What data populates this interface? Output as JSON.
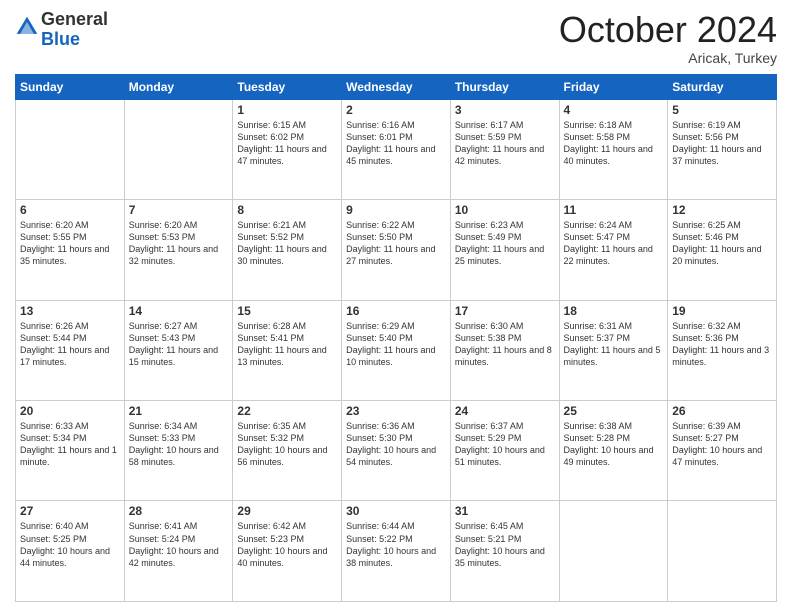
{
  "header": {
    "logo_line1": "General",
    "logo_line2": "Blue",
    "month": "October 2024",
    "location": "Aricak, Turkey"
  },
  "days_of_week": [
    "Sunday",
    "Monday",
    "Tuesday",
    "Wednesday",
    "Thursday",
    "Friday",
    "Saturday"
  ],
  "weeks": [
    [
      {
        "day": "",
        "info": ""
      },
      {
        "day": "",
        "info": ""
      },
      {
        "day": "1",
        "info": "Sunrise: 6:15 AM\nSunset: 6:02 PM\nDaylight: 11 hours and 47 minutes."
      },
      {
        "day": "2",
        "info": "Sunrise: 6:16 AM\nSunset: 6:01 PM\nDaylight: 11 hours and 45 minutes."
      },
      {
        "day": "3",
        "info": "Sunrise: 6:17 AM\nSunset: 5:59 PM\nDaylight: 11 hours and 42 minutes."
      },
      {
        "day": "4",
        "info": "Sunrise: 6:18 AM\nSunset: 5:58 PM\nDaylight: 11 hours and 40 minutes."
      },
      {
        "day": "5",
        "info": "Sunrise: 6:19 AM\nSunset: 5:56 PM\nDaylight: 11 hours and 37 minutes."
      }
    ],
    [
      {
        "day": "6",
        "info": "Sunrise: 6:20 AM\nSunset: 5:55 PM\nDaylight: 11 hours and 35 minutes."
      },
      {
        "day": "7",
        "info": "Sunrise: 6:20 AM\nSunset: 5:53 PM\nDaylight: 11 hours and 32 minutes."
      },
      {
        "day": "8",
        "info": "Sunrise: 6:21 AM\nSunset: 5:52 PM\nDaylight: 11 hours and 30 minutes."
      },
      {
        "day": "9",
        "info": "Sunrise: 6:22 AM\nSunset: 5:50 PM\nDaylight: 11 hours and 27 minutes."
      },
      {
        "day": "10",
        "info": "Sunrise: 6:23 AM\nSunset: 5:49 PM\nDaylight: 11 hours and 25 minutes."
      },
      {
        "day": "11",
        "info": "Sunrise: 6:24 AM\nSunset: 5:47 PM\nDaylight: 11 hours and 22 minutes."
      },
      {
        "day": "12",
        "info": "Sunrise: 6:25 AM\nSunset: 5:46 PM\nDaylight: 11 hours and 20 minutes."
      }
    ],
    [
      {
        "day": "13",
        "info": "Sunrise: 6:26 AM\nSunset: 5:44 PM\nDaylight: 11 hours and 17 minutes."
      },
      {
        "day": "14",
        "info": "Sunrise: 6:27 AM\nSunset: 5:43 PM\nDaylight: 11 hours and 15 minutes."
      },
      {
        "day": "15",
        "info": "Sunrise: 6:28 AM\nSunset: 5:41 PM\nDaylight: 11 hours and 13 minutes."
      },
      {
        "day": "16",
        "info": "Sunrise: 6:29 AM\nSunset: 5:40 PM\nDaylight: 11 hours and 10 minutes."
      },
      {
        "day": "17",
        "info": "Sunrise: 6:30 AM\nSunset: 5:38 PM\nDaylight: 11 hours and 8 minutes."
      },
      {
        "day": "18",
        "info": "Sunrise: 6:31 AM\nSunset: 5:37 PM\nDaylight: 11 hours and 5 minutes."
      },
      {
        "day": "19",
        "info": "Sunrise: 6:32 AM\nSunset: 5:36 PM\nDaylight: 11 hours and 3 minutes."
      }
    ],
    [
      {
        "day": "20",
        "info": "Sunrise: 6:33 AM\nSunset: 5:34 PM\nDaylight: 11 hours and 1 minute."
      },
      {
        "day": "21",
        "info": "Sunrise: 6:34 AM\nSunset: 5:33 PM\nDaylight: 10 hours and 58 minutes."
      },
      {
        "day": "22",
        "info": "Sunrise: 6:35 AM\nSunset: 5:32 PM\nDaylight: 10 hours and 56 minutes."
      },
      {
        "day": "23",
        "info": "Sunrise: 6:36 AM\nSunset: 5:30 PM\nDaylight: 10 hours and 54 minutes."
      },
      {
        "day": "24",
        "info": "Sunrise: 6:37 AM\nSunset: 5:29 PM\nDaylight: 10 hours and 51 minutes."
      },
      {
        "day": "25",
        "info": "Sunrise: 6:38 AM\nSunset: 5:28 PM\nDaylight: 10 hours and 49 minutes."
      },
      {
        "day": "26",
        "info": "Sunrise: 6:39 AM\nSunset: 5:27 PM\nDaylight: 10 hours and 47 minutes."
      }
    ],
    [
      {
        "day": "27",
        "info": "Sunrise: 6:40 AM\nSunset: 5:25 PM\nDaylight: 10 hours and 44 minutes."
      },
      {
        "day": "28",
        "info": "Sunrise: 6:41 AM\nSunset: 5:24 PM\nDaylight: 10 hours and 42 minutes."
      },
      {
        "day": "29",
        "info": "Sunrise: 6:42 AM\nSunset: 5:23 PM\nDaylight: 10 hours and 40 minutes."
      },
      {
        "day": "30",
        "info": "Sunrise: 6:44 AM\nSunset: 5:22 PM\nDaylight: 10 hours and 38 minutes."
      },
      {
        "day": "31",
        "info": "Sunrise: 6:45 AM\nSunset: 5:21 PM\nDaylight: 10 hours and 35 minutes."
      },
      {
        "day": "",
        "info": ""
      },
      {
        "day": "",
        "info": ""
      }
    ]
  ]
}
